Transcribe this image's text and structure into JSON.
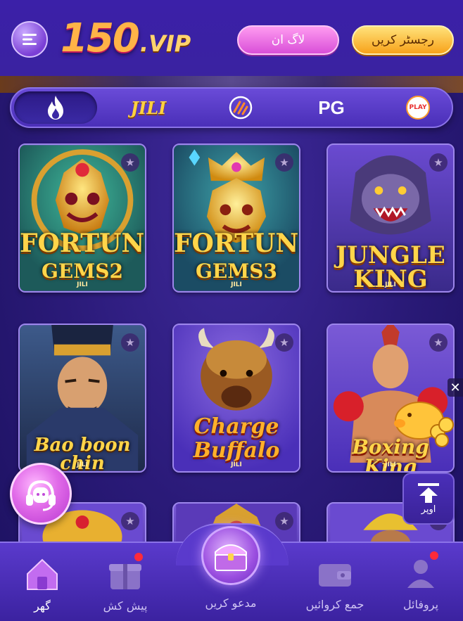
{
  "header": {
    "logo_number": "150",
    "logo_suffix": ".VIP",
    "login_label": "لاگ ان",
    "register_label": "رجسٹر کریں"
  },
  "tabs": [
    {
      "label": "",
      "icon": "flame-icon",
      "active": true
    },
    {
      "label": "JILI",
      "icon": "",
      "active": false
    },
    {
      "label": "",
      "icon": "hacksaw-icon",
      "active": false
    },
    {
      "label": "PG",
      "icon": "",
      "active": false
    },
    {
      "label": "PLAY",
      "icon": "play-circle-icon",
      "active": false
    }
  ],
  "games": [
    {
      "title": "FORTUNE",
      "subtitle": "GEMS2",
      "provider": "JILI"
    },
    {
      "title": "FORTUNE",
      "subtitle": "GEMS3",
      "provider": "JILI"
    },
    {
      "title": "JUNGLE KING",
      "subtitle": "",
      "provider": "JILI"
    },
    {
      "title": "Bao boon chin",
      "subtitle": "",
      "provider": "JILI"
    },
    {
      "title": "Charge",
      "subtitle": "Buffalo",
      "provider": "JILI"
    },
    {
      "title": "Boxing King",
      "subtitle": "",
      "provider": "JILI"
    }
  ],
  "floating": {
    "scroll_top_label": "اوپر",
    "close_label": "✕"
  },
  "bottom_nav": [
    {
      "label": "گھر",
      "icon": "home-icon",
      "active": true
    },
    {
      "label": "پیش کش",
      "icon": "gift-icon",
      "active": false,
      "dot": true
    },
    {
      "label": "مدعو کریں",
      "icon": "treasure-chest-icon",
      "active": false
    },
    {
      "label": "جمع کروائیں",
      "icon": "wallet-icon",
      "active": false
    },
    {
      "label": "پروفائل",
      "icon": "profile-icon",
      "active": false,
      "dot": true
    }
  ],
  "colors": {
    "background": "#2a1a78",
    "login_button": "#d94fd8",
    "register_button": "#f7a21a",
    "accent_gold": "#ffd23f"
  }
}
